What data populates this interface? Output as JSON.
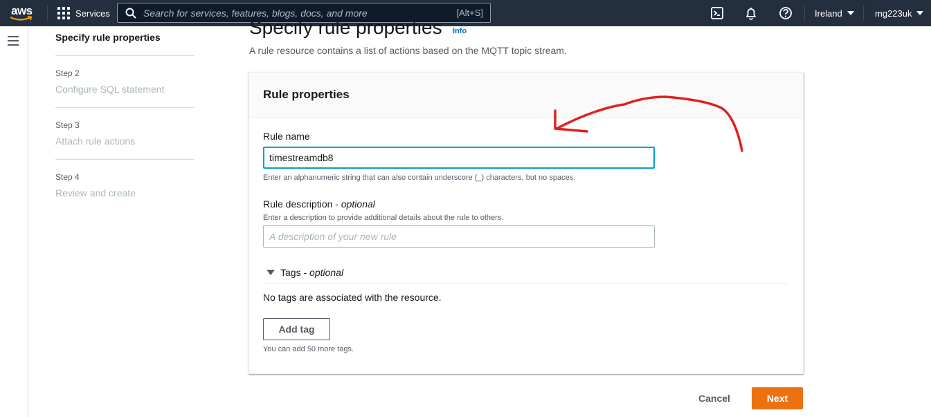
{
  "topbar": {
    "logo_text": "aws",
    "services_label": "Services",
    "search_placeholder": "Search for services, features, blogs, docs, and more",
    "search_shortcut": "[Alt+S]",
    "region_label": "Ireland",
    "account_label": "mg223uk",
    "icons": [
      "cloudshell-icon",
      "notifications-icon",
      "help-icon"
    ]
  },
  "steps": {
    "current_title": "Specify rule properties",
    "items": [
      {
        "number": "Step 2",
        "title": "Configure SQL statement"
      },
      {
        "number": "Step 3",
        "title": "Attach rule actions"
      },
      {
        "number": "Step 4",
        "title": "Review and create"
      }
    ]
  },
  "header": {
    "title": "Specify rule properties",
    "info_label": "Info",
    "description": "A rule resource contains a list of actions based on the MQTT topic stream."
  },
  "rule_properties": {
    "title": "Rule properties",
    "rule_name": {
      "label": "Rule name",
      "value": "timestreamdb8",
      "hint": "Enter an alphanumeric string that can also contain underscore (_) characters, but no spaces."
    },
    "rule_description": {
      "label": "Rule description",
      "optional": "optional",
      "hint": "Enter a description to provide additional details about the rule to others.",
      "placeholder": "A description of your new rule"
    },
    "tags": {
      "label": "Tags",
      "optional": "optional",
      "empty_text": "No tags are associated with the resource.",
      "add_button": "Add tag",
      "remaining_text": "You can add 50 more tags."
    }
  },
  "footer": {
    "cancel_label": "Cancel",
    "next_label": "Next"
  },
  "colors": {
    "nav_bg": "#232f3e",
    "primary_button": "#ec7211",
    "focus_border": "#00a1c9",
    "link": "#0073bb",
    "annotation": "#e0201c"
  }
}
